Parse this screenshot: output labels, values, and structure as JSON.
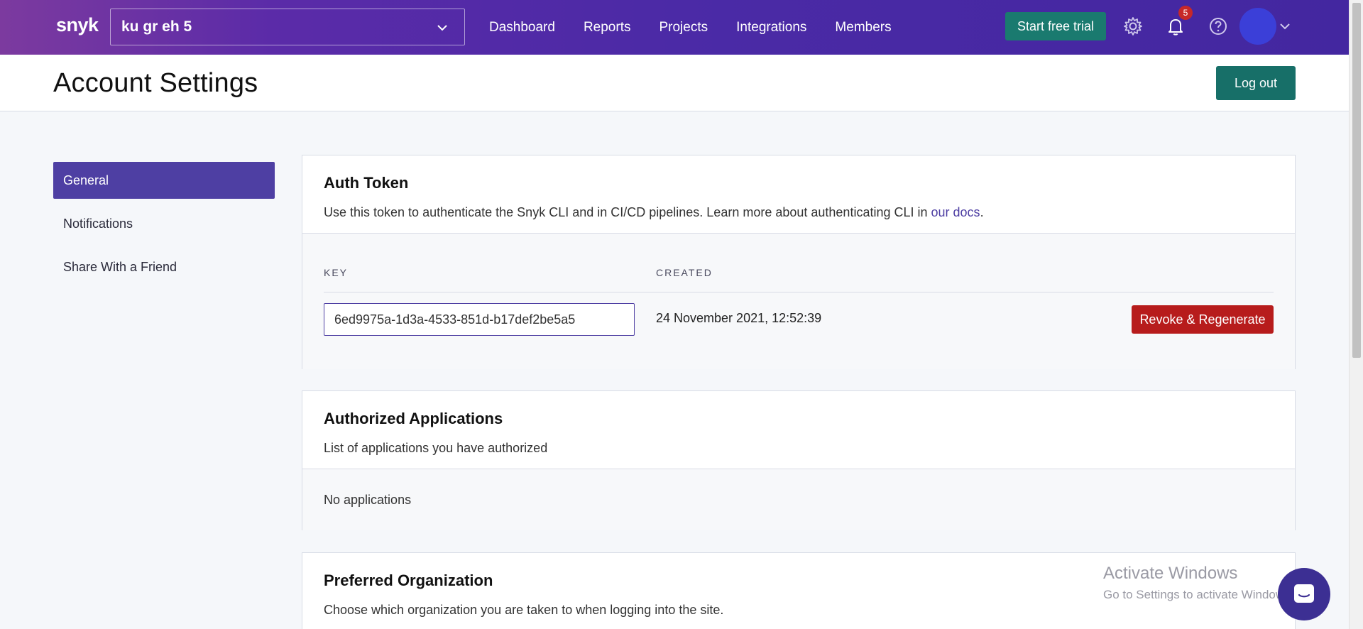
{
  "nav": {
    "logo": "snyk",
    "org_name": "ku  gr  eh  5",
    "links": [
      "Dashboard",
      "Reports",
      "Projects",
      "Integrations",
      "Members"
    ],
    "trial_label": "Start free trial",
    "notification_count": "5"
  },
  "header": {
    "title": "Account Settings",
    "logout_label": "Log out"
  },
  "sidebar": {
    "items": [
      {
        "label": "General",
        "active": true
      },
      {
        "label": "Notifications",
        "active": false
      },
      {
        "label": "Share With a Friend",
        "active": false
      }
    ]
  },
  "auth_token": {
    "title": "Auth Token",
    "desc_prefix": "Use this token to authenticate the Snyk CLI and in CI/CD pipelines. Learn more about authenticating CLI in ",
    "desc_link": "our docs",
    "desc_suffix": ".",
    "key_header": "KEY",
    "created_header": "CREATED",
    "key_value": "6ed9975a-1d3a-4533-851d-b17def2be5a5",
    "created_value": "24 November 2021, 12:52:39",
    "revoke_label": "Revoke & Regenerate"
  },
  "authorized_apps": {
    "title": "Authorized Applications",
    "desc": "List of applications you have authorized",
    "empty": "No applications"
  },
  "preferred_org": {
    "title": "Preferred Organization",
    "desc": "Choose which organization you are taken to when logging into the site."
  },
  "watermark": {
    "line1": "Activate Windows",
    "line2": "Go to Settings to activate Windows."
  }
}
